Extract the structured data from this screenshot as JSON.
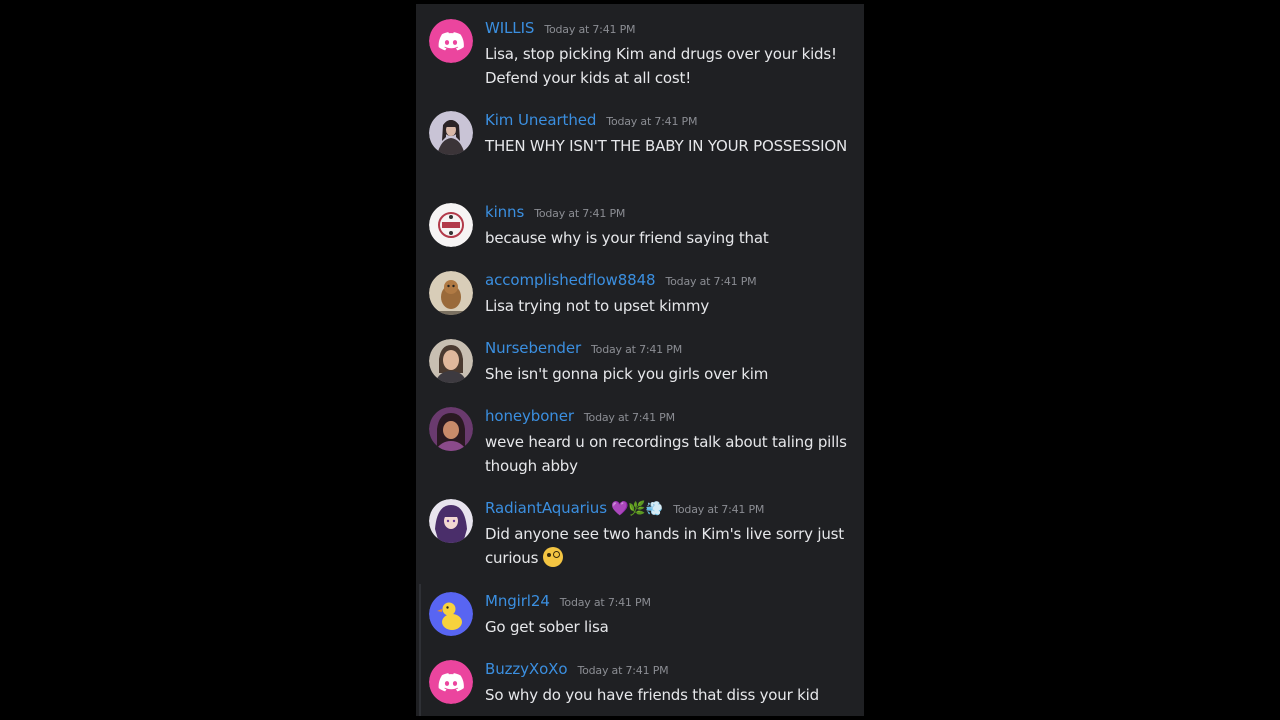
{
  "messages": [
    {
      "username": "WILLIS",
      "timestamp": "Today at 7:41 PM",
      "text": "Lisa, stop picking Kim and drugs over your kids! Defend your kids at all cost!",
      "avatar": "discord-logo-icon"
    },
    {
      "username": "Kim Unearthed",
      "timestamp": "Today at 7:41 PM",
      "text": "THEN WHY ISN'T THE BABY IN YOUR POSSESSION",
      "avatar": "user-photo-avatar"
    },
    {
      "username": "kinns",
      "timestamp": "Today at 7:41 PM",
      "text": "because why is your friend saying that",
      "avatar": "logo-avatar"
    },
    {
      "username": "accomplishedflow8848",
      "timestamp": "Today at 7:41 PM",
      "text": "Lisa trying not to upset kimmy",
      "avatar": "animal-photo-avatar"
    },
    {
      "username": "Nursebender",
      "timestamp": "Today at 7:41 PM",
      "text": "She isn't gonna pick you girls over kim",
      "avatar": "user-photo-avatar"
    },
    {
      "username": "honeyboner",
      "timestamp": "Today at 7:41 PM",
      "text": "weve heard u on recordings talk about taling pills though abby",
      "avatar": "user-photo-avatar"
    },
    {
      "username": "RadiantAquarius",
      "username_emojis": "💜🌿💨",
      "timestamp": "Today at 7:41 PM",
      "text": "Did anyone see two hands in Kim's live sorry just curious",
      "text_emoji": "monocle-face-emoji",
      "avatar": "anime-avatar"
    },
    {
      "username": "Mngirl24",
      "timestamp": "Today at 7:41 PM",
      "text": "Go get sober lisa",
      "avatar": "duck-avatar"
    },
    {
      "username": "BuzzyXoXo",
      "timestamp": "Today at 7:41 PM",
      "text": "So why do you have friends that diss your kid",
      "avatar": "discord-logo-icon"
    }
  ],
  "colors": {
    "background": "#000000",
    "panel": "#1f2023",
    "username": "#3b8fe0",
    "timestamp": "#8b8d93",
    "message_text": "#e6e7ea",
    "discord_pink": "#eb459e"
  }
}
